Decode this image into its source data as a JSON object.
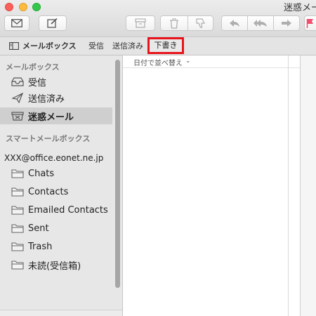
{
  "window": {
    "title": "迷惑メール"
  },
  "favorites_bar": {
    "mailboxes_label": "メールボックス",
    "items": [
      {
        "label": "受信"
      },
      {
        "label": "送信済み"
      },
      {
        "label": "下書き",
        "highlighted": true
      }
    ]
  },
  "sidebar": {
    "section_mailboxes": "メールボックス",
    "mailboxes": [
      {
        "label": "受信",
        "icon": "inbox-tray-icon"
      },
      {
        "label": "送信済み",
        "icon": "paper-plane-icon"
      },
      {
        "label": "迷惑メール",
        "icon": "junk-bin-icon",
        "selected": true
      }
    ],
    "section_smart": "スマートメールボックス",
    "account": "XXX@office.eonet.ne.jp",
    "folders": [
      {
        "label": "Chats",
        "icon": "folder-icon"
      },
      {
        "label": "Contacts",
        "icon": "folder-icon"
      },
      {
        "label": "Emailed Contacts",
        "icon": "folder-icon"
      },
      {
        "label": "Sent",
        "icon": "folder-icon"
      },
      {
        "label": "Trash",
        "icon": "folder-icon"
      },
      {
        "label": "未読(受信箱)",
        "icon": "folder-icon"
      }
    ]
  },
  "message_list": {
    "sort_label": "日付で並べ替え"
  },
  "colors": {
    "highlight_border": "#e8141b",
    "selected_row": "#cfcfcf",
    "flag": "#f0506e"
  }
}
